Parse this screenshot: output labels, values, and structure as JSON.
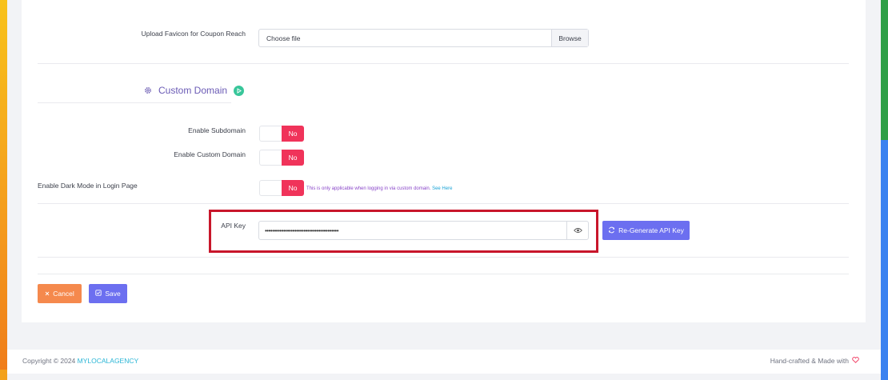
{
  "upload_favicon": {
    "label": "Upload Favicon for Coupon Reach",
    "file_text": "Choose file",
    "browse_label": "Browse"
  },
  "custom_domain": {
    "title": "Custom Domain",
    "icon": "gear-icon",
    "video_icon": "play-icon",
    "accent": "#6a5ab5"
  },
  "toggles": {
    "subdomain": {
      "label": "Enable Subdomain",
      "value": "No"
    },
    "custom_domain": {
      "label": "Enable Custom Domain",
      "value": "No"
    },
    "dark_mode": {
      "label": "Enable Dark Mode in Login Page",
      "value": "No"
    }
  },
  "dark_mode_help": {
    "text": "This is only applicable when logging in via custom domain.",
    "link": "See Here"
  },
  "api_key": {
    "label": "API Key",
    "value": "••••••••••••••••••••••••••••••••••••••••",
    "reveal_icon": "eye-icon",
    "regenerate_label": "Re-Generate API Key"
  },
  "actions": {
    "cancel_label": "Cancel",
    "save_label": "Save"
  },
  "footer": {
    "copyright_prefix": "Copyright © 2024",
    "brand": "MYLOCALAGENCY",
    "made_with": "Hand-crafted & Made with"
  },
  "colors": {
    "toggle_no": "#f0335a",
    "primary_button": "#6c6ff0",
    "cancel_button": "#f5894d",
    "highlight_border": "#c8162b"
  }
}
